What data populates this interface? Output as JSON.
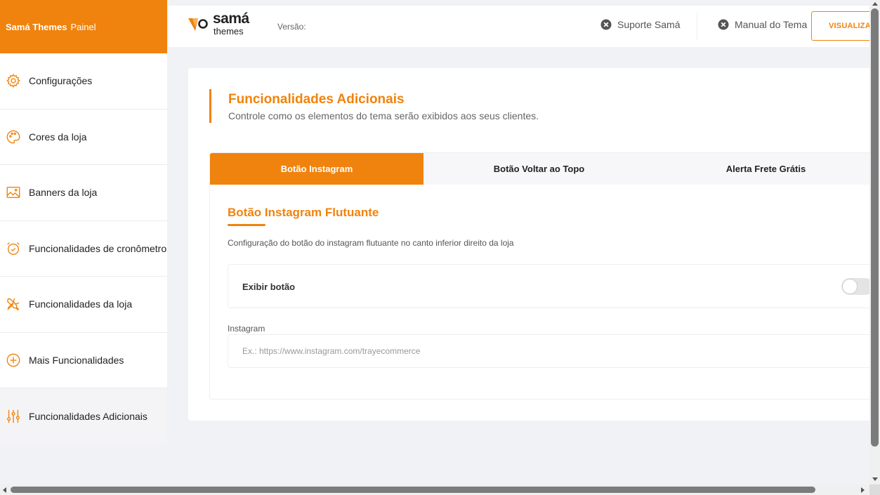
{
  "sidebar": {
    "brand": {
      "name": "Samá Themes",
      "suffix": "Painel"
    },
    "items": [
      {
        "label": "Configurações",
        "icon": "gear-icon"
      },
      {
        "label": "Cores da loja",
        "icon": "palette-icon"
      },
      {
        "label": "Banners da loja",
        "icon": "image-icon"
      },
      {
        "label": "Funcionalidades de cronômetro",
        "icon": "alarm-clock-icon"
      },
      {
        "label": "Funcionalidades da loja",
        "icon": "tools-icon"
      },
      {
        "label": "Mais Funcionalidades",
        "icon": "plus-circle-icon"
      },
      {
        "label": "Funcionalidades Adicionais",
        "icon": "sliders-icon",
        "active": true
      }
    ]
  },
  "topbar": {
    "logo": {
      "line1": "samá",
      "line2": "themes"
    },
    "version_label": "Versão:",
    "support_label": "Suporte Samá",
    "manual_label": "Manual do Tema",
    "preview_button": "VISUALIZAR"
  },
  "main": {
    "title": "Funcionalidades Adicionais",
    "subtitle": "Controle como os elementos do tema serão exibidos aos seus clientes.",
    "tabs": [
      {
        "label": "Botão Instagram",
        "active": true
      },
      {
        "label": "Botão Voltar ao Topo",
        "active": false
      },
      {
        "label": "Alerta Frete Grátis",
        "active": false
      }
    ],
    "section": {
      "title": "Botão Instagram Flutuante",
      "description": "Configuração do botão do instagram flutuante no canto inferior direito da loja",
      "toggle_label": "Exibir botão",
      "toggle_on": false,
      "field_label": "Instagram",
      "field_value": "",
      "field_placeholder": "Ex.: https://www.instagram.com/trayecommerce"
    }
  },
  "colors": {
    "accent": "#f0830d",
    "background": "#f1f2f5",
    "surface": "#ffffff"
  }
}
